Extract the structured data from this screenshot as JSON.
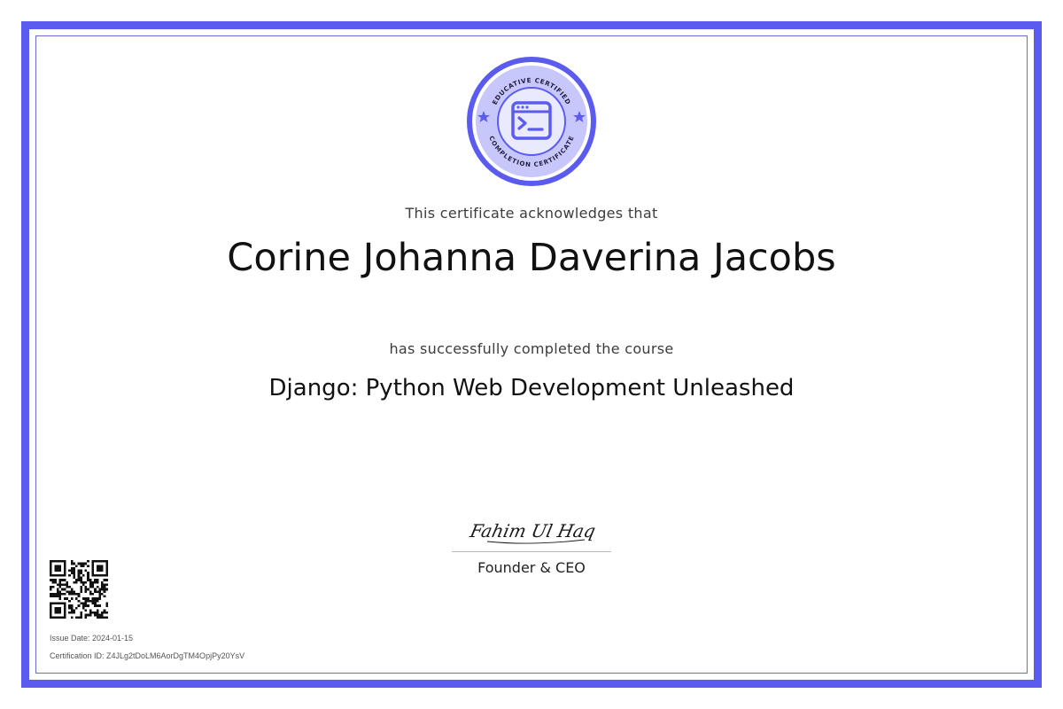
{
  "colors": {
    "accent": "#5b5bef",
    "accent_light": "#c7c7fb",
    "accent_inner": "#eaeafe",
    "text": "#111111"
  },
  "seal": {
    "icon": "terminal-window-icon",
    "top_text": "EDUCATIVE CERTIFIED",
    "bottom_text": "COMPLETION CERTIFICATE"
  },
  "certificate": {
    "acknowledges": "This certificate acknowledges that",
    "recipient_name": "Corine Johanna Daverina Jacobs",
    "completed_text": "has successfully completed the course",
    "course_title": "Django: Python Web Development Unleashed"
  },
  "signature": {
    "signature_text": "Fahim Ul Haq",
    "signer_title": "Founder & CEO"
  },
  "meta": {
    "issue_date": "Issue Date: 2024-01-15",
    "certification_id": "Certification ID: Z4JLg2tDoLM6AorDgTM4OpjPy20YsV"
  }
}
